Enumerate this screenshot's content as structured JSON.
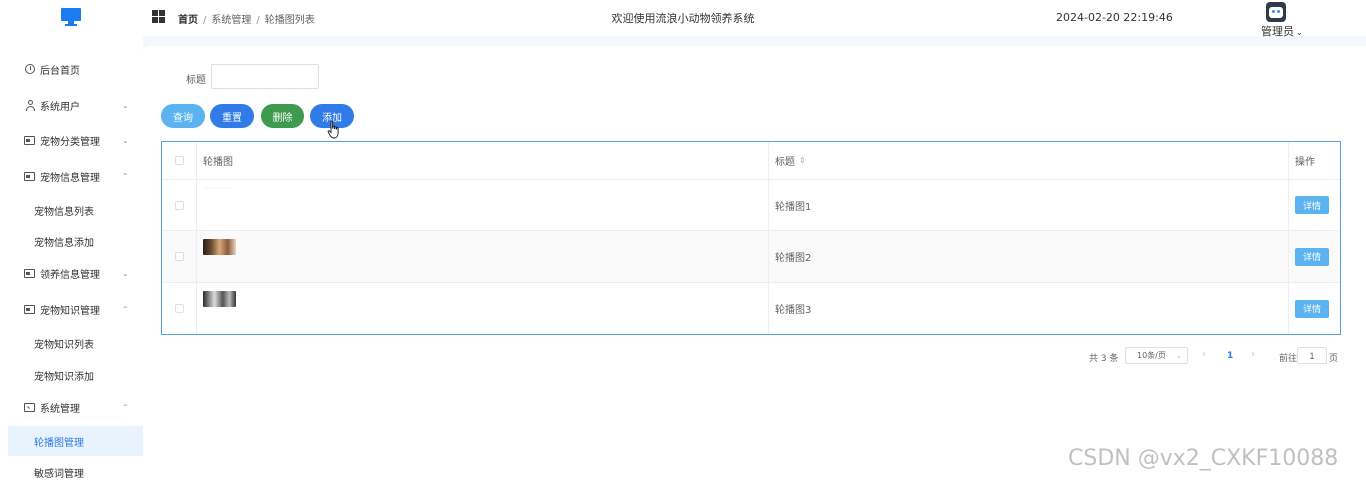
{
  "header": {
    "breadcrumb": [
      "首页",
      "系统管理",
      "轮播图列表"
    ],
    "breadcrumb_sep": "/",
    "welcome": "欢迎使用流浪小动物领养系统",
    "datetime": "2024-02-20 22:19:46",
    "user": "管理员"
  },
  "sidebar": {
    "items": [
      {
        "label": "后台首页",
        "icon": "clock-icon"
      },
      {
        "label": "系统用户",
        "icon": "user-icon"
      },
      {
        "label": "宠物分类管理",
        "icon": "card-icon"
      },
      {
        "label": "宠物信息管理",
        "icon": "card-icon"
      },
      {
        "label": "宠物信息列表"
      },
      {
        "label": "宠物信息添加"
      },
      {
        "label": "领养信息管理",
        "icon": "card-icon"
      },
      {
        "label": "宠物知识管理",
        "icon": "card-icon"
      },
      {
        "label": "宠物知识列表"
      },
      {
        "label": "宠物知识添加"
      },
      {
        "label": "系统管理",
        "icon": "folder-icon"
      },
      {
        "label": "轮播图管理"
      },
      {
        "label": "敏感词管理"
      }
    ]
  },
  "search": {
    "label": "标题",
    "value": "",
    "placeholder": ""
  },
  "toolbar": {
    "query": "查询",
    "reset": "重置",
    "delete": "删除",
    "add": "添加"
  },
  "table": {
    "headers": {
      "image": "轮播图",
      "title": "标题",
      "op": "操作"
    },
    "rows": [
      {
        "title": "轮播图1",
        "op": "详情"
      },
      {
        "title": "轮播图2",
        "op": "详情"
      },
      {
        "title": "轮播图3",
        "op": "详情"
      }
    ]
  },
  "pager": {
    "total": "共 3 条",
    "size": "10条/页",
    "current": "1",
    "goto": "前往",
    "goto_value": "1",
    "page_suffix": "页"
  },
  "watermark": "CSDN @vx2_CXKF10088",
  "colors": {
    "primary": "#2f7be8",
    "info": "#5bb3ef",
    "success": "#3d9a4e",
    "active_bg": "#e9f3fd"
  }
}
